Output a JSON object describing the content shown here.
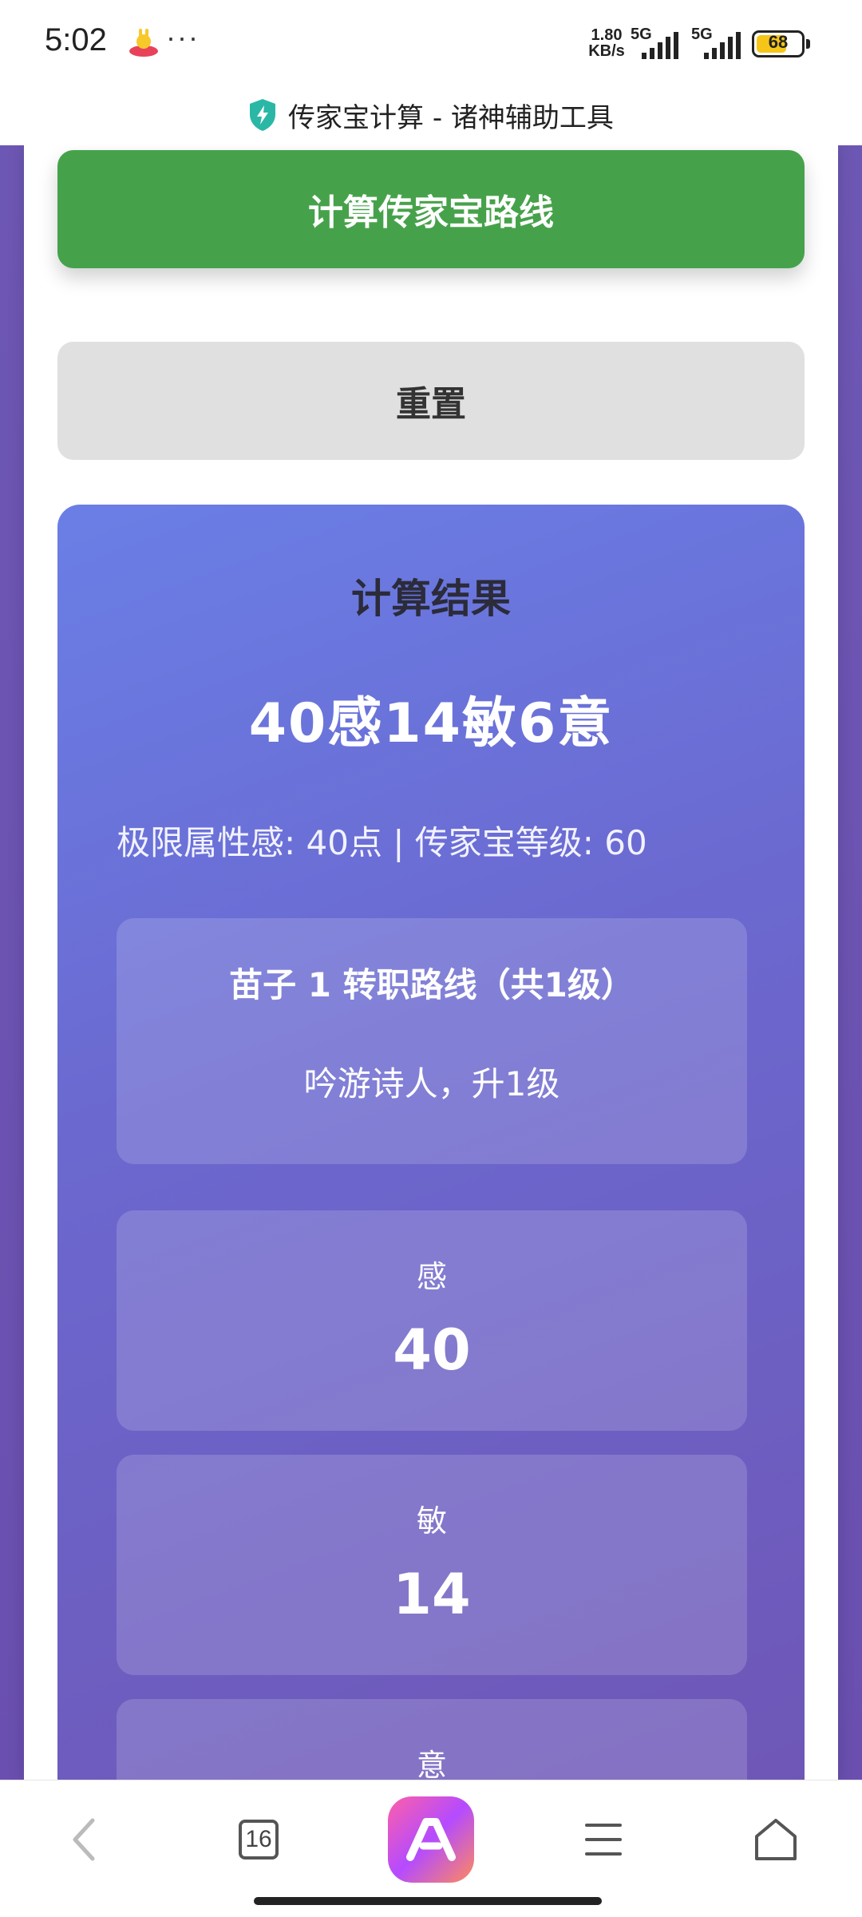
{
  "status_bar": {
    "time": "5:02",
    "more": "···",
    "speed_value": "1.80",
    "speed_unit": "KB/s",
    "signal1_label": "5G",
    "signal2_label": "5G",
    "battery": "68",
    "battery_level": 0.68,
    "icons": [
      "app-mascot-icon",
      "signal-icon",
      "signal-icon",
      "battery-icon"
    ]
  },
  "browser": {
    "title": "传家宝计算 - 诸神辅助工具",
    "title_icon": "shield-bolt-icon"
  },
  "actions": {
    "calc_label": "计算传家宝路线",
    "reset_label": "重置"
  },
  "result": {
    "title": "计算结果",
    "summary": "40感14敏6意",
    "info": "极限属性感: 40点 | 传家宝等级: 60",
    "route": {
      "title": "苗子 1 转职路线（共1级）",
      "desc": "吟游诗人，升1级"
    },
    "stats": [
      {
        "label": "感",
        "value": "40"
      },
      {
        "label": "敏",
        "value": "14"
      },
      {
        "label": "意",
        "value": ""
      }
    ]
  },
  "bottom_nav": {
    "tab_count": "16",
    "icons": [
      "back-icon",
      "tabs-icon",
      "browser-app-icon",
      "menu-icon",
      "home-icon"
    ]
  },
  "colors": {
    "calc_button": "#46a24a",
    "reset_button": "#e0e0e0",
    "result_gradient_start": "#6a7fe6",
    "result_gradient_end": "#6f55b4",
    "page_background": "#6d57b4"
  }
}
